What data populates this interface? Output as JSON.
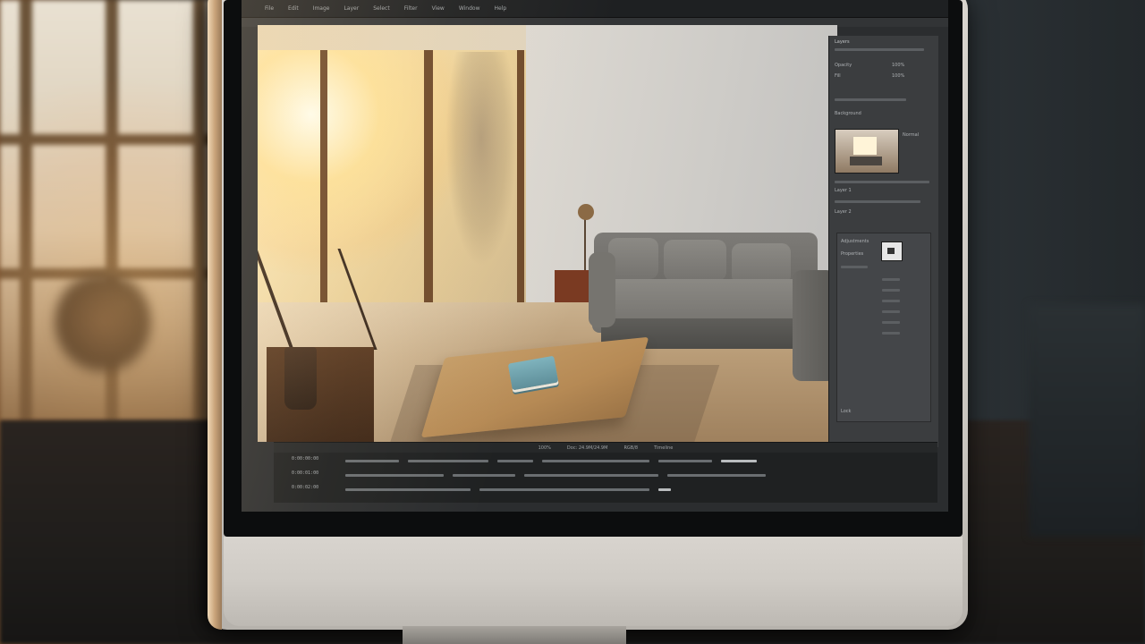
{
  "app": {
    "menu": [
      "File",
      "Edit",
      "Image",
      "Layer",
      "Select",
      "Filter",
      "View",
      "Window",
      "Help"
    ],
    "panel": {
      "header": "Layers",
      "rows": [
        "Opacity",
        "Fill",
        "Background",
        "Layer 1",
        "Layer 2",
        "Adjustments",
        "Properties"
      ],
      "values": [
        "100%",
        "100%",
        "Normal",
        "Lock"
      ]
    },
    "status": [
      "100%",
      "Doc: 24.9M/24.9M",
      "RGB/8",
      "Timeline"
    ],
    "timeline_rows": [
      "0:00:00:00",
      "0:00:01:00",
      "0:00:02:00"
    ]
  },
  "colors": {
    "ui_dark": "#2b2d2f",
    "ui_panel": "#3b3d3f",
    "monitor_silver": "#cfcbc5",
    "sofa_gray": "#7d7b77",
    "table_wood": "#b68a55",
    "book_teal": "#7fb3bd"
  },
  "icons": [
    "monitor-icon"
  ]
}
